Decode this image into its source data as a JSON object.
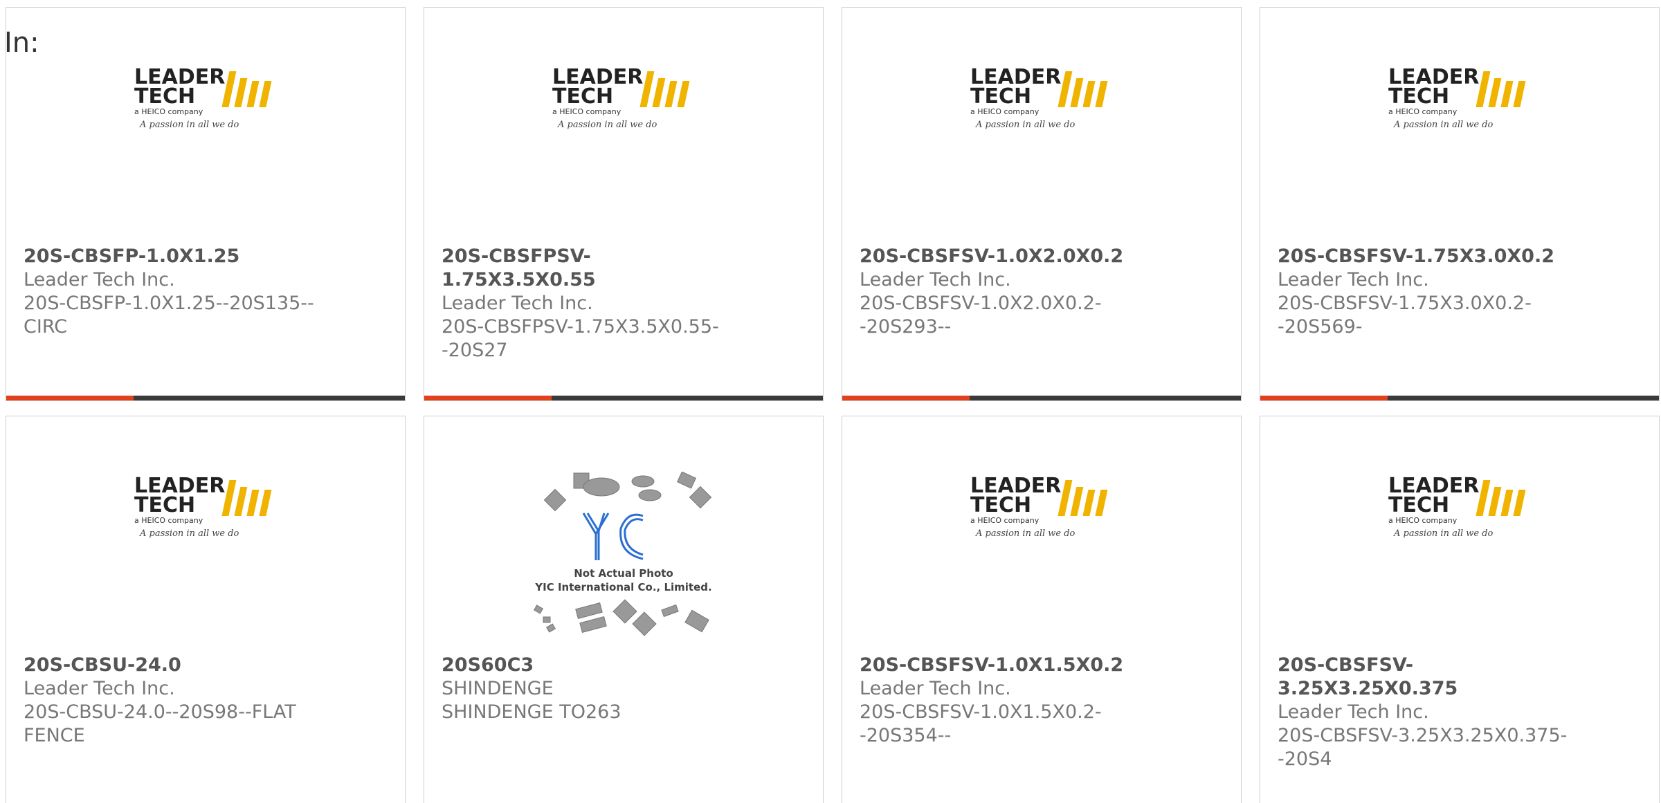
{
  "header": {
    "label": "In:"
  },
  "colors": {
    "accent": "#e2401c",
    "bar_track": "#3a3a3a",
    "card_border": "#cfcfcf",
    "logo_yellow": "#f0b400"
  },
  "logo": {
    "leader_line1": "LEADER",
    "leader_line2": "TECH",
    "leader_sub": "a HEICO company",
    "leader_tag": "A passion in all we do",
    "yic_caption1": "Not Actual Photo",
    "yic_caption2": "YIC International Co., Limited."
  },
  "cards": [
    {
      "title": "20S-CBSFP-1.0X1.25",
      "maker": "Leader Tech Inc.",
      "desc": "20S-CBSFP-1.0X1.25--20S135--CIRC",
      "image": "leader-tech-logo",
      "progress": 0.32
    },
    {
      "title": "20S-CBSFPSV-1.75X3.5X0.55",
      "maker": "Leader Tech Inc.",
      "desc": "20S-CBSFPSV-1.75X3.5X0.55--20S27",
      "image": "leader-tech-logo",
      "progress": 0.32
    },
    {
      "title": "20S-CBSFSV-1.0X2.0X0.2",
      "maker": "Leader Tech Inc.",
      "desc": "20S-CBSFSV-1.0X2.0X0.2--20S293--",
      "image": "leader-tech-logo",
      "progress": 0.32
    },
    {
      "title": "20S-CBSFSV-1.75X3.0X0.2",
      "maker": "Leader Tech Inc.",
      "desc": "20S-CBSFSV-1.75X3.0X0.2--20S569-",
      "image": "leader-tech-logo",
      "progress": 0.32
    },
    {
      "title": "20S-CBSU-24.0",
      "maker": "Leader Tech Inc.",
      "desc": "20S-CBSU-24.0--20S98--FLAT FENCE",
      "image": "leader-tech-logo"
    },
    {
      "title": "20S60C3",
      "maker": "SHINDENGE",
      "desc": "SHINDENGE TO263",
      "image": "yic-placeholder"
    },
    {
      "title": "20S-CBSFSV-1.0X1.5X0.2",
      "maker": "Leader Tech Inc.",
      "desc": "20S-CBSFSV-1.0X1.5X0.2--20S354--",
      "image": "leader-tech-logo"
    },
    {
      "title": "20S-CBSFSV-3.25X3.25X0.375",
      "maker": "Leader Tech Inc.",
      "desc": "20S-CBSFSV-3.25X3.25X0.375--20S4",
      "image": "leader-tech-logo"
    }
  ]
}
